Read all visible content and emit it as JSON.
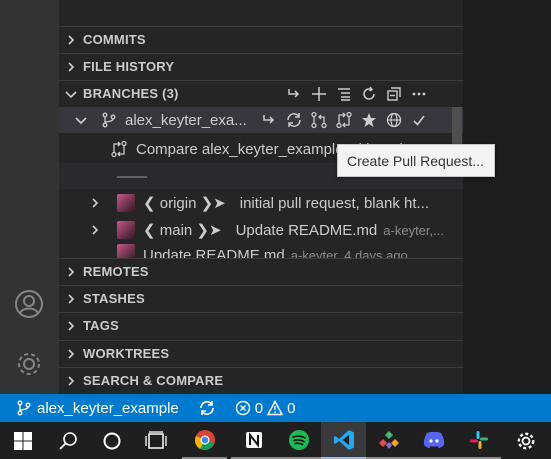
{
  "sidebar": {
    "sections_top": [
      {
        "label": "COMMITS"
      },
      {
        "label": "FILE HISTORY"
      }
    ],
    "branches": {
      "label": "BRANCHES (3)",
      "action_icons": [
        "switch-branch-icon",
        "add-icon",
        "list-view-icon",
        "refresh-icon",
        "collapse-all-icon",
        "more-actions-icon"
      ],
      "current": {
        "label": "alex_keyter_exa...",
        "action_icons": [
          "switch-to-branch-icon",
          "sync-icon",
          "create-pull-request-icon",
          "compare-icon",
          "star-icon",
          "globe-icon",
          "checkmark-icon"
        ]
      },
      "compare_row": "Compare alex_keyter_example with main",
      "separator_row": "——",
      "commits": [
        {
          "refs": "❮ origin ❯➤",
          "message": "initial pull request, blank ht...",
          "meta": ""
        },
        {
          "refs": "❮ main ❯➤",
          "message": "Update README.md",
          "meta": "a-keyter,..."
        },
        {
          "refs": "",
          "message": "Update README.md",
          "meta": "a-keyter, 4 days ago"
        }
      ]
    },
    "sections_bottom": [
      {
        "label": "REMOTES"
      },
      {
        "label": "STASHES"
      },
      {
        "label": "TAGS"
      },
      {
        "label": "WORKTREES"
      },
      {
        "label": "SEARCH & COMPARE"
      }
    ]
  },
  "tooltip": {
    "text": "Create Pull Request..."
  },
  "status_bar": {
    "branch": "alex_keyter_example",
    "errors": "0",
    "warnings": "0"
  },
  "taskbar": {
    "apps": [
      "windows-start-icon",
      "search-icon",
      "cortana-icon",
      "task-view-icon",
      "chrome-icon",
      "notion-icon",
      "spotify-icon",
      "vscode-icon",
      "gitkraken-icon",
      "discord-icon",
      "slack-icon",
      "settings-icon"
    ]
  },
  "colors": {
    "status_bar": "#007acc",
    "sidebar": "#252526",
    "activity_bar": "#333333",
    "selection": "#37373d",
    "tooltip_bg": "#f3f3f3"
  }
}
